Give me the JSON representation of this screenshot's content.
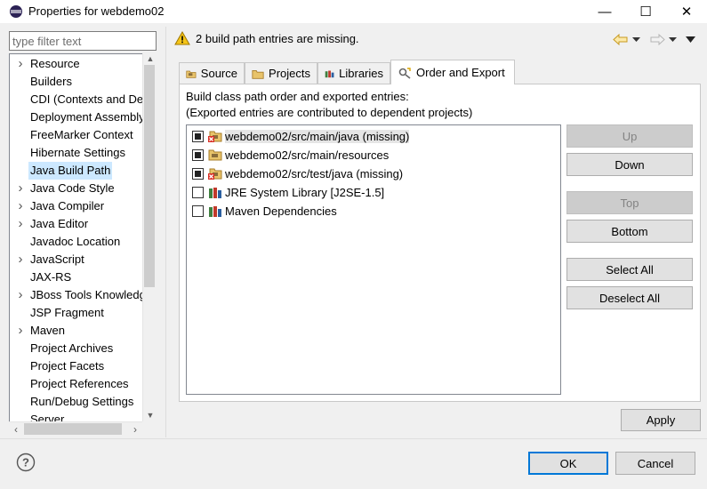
{
  "window": {
    "title": "Properties for webdemo02",
    "minimize_glyph": "—",
    "maximize_glyph": "☐",
    "close_glyph": "✕",
    "icon": "eclipse-icon"
  },
  "filter": {
    "placeholder": "type filter text",
    "value": ""
  },
  "tree": {
    "items": [
      {
        "label": "Resource",
        "expandable": true
      },
      {
        "label": "Builders",
        "expandable": false
      },
      {
        "label": "CDI (Contexts and De",
        "expandable": false
      },
      {
        "label": "Deployment Assembly",
        "expandable": false
      },
      {
        "label": "FreeMarker Context",
        "expandable": false
      },
      {
        "label": "Hibernate Settings",
        "expandable": false
      },
      {
        "label": "Java Build Path",
        "expandable": false,
        "selected": true
      },
      {
        "label": "Java Code Style",
        "expandable": true
      },
      {
        "label": "Java Compiler",
        "expandable": true
      },
      {
        "label": "Java Editor",
        "expandable": true
      },
      {
        "label": "Javadoc Location",
        "expandable": false
      },
      {
        "label": "JavaScript",
        "expandable": true
      },
      {
        "label": "JAX-RS",
        "expandable": false
      },
      {
        "label": "JBoss Tools Knowledg",
        "expandable": true
      },
      {
        "label": "JSP Fragment",
        "expandable": false
      },
      {
        "label": "Maven",
        "expandable": true
      },
      {
        "label": "Project Archives",
        "expandable": false
      },
      {
        "label": "Project Facets",
        "expandable": false
      },
      {
        "label": "Project References",
        "expandable": false
      },
      {
        "label": "Run/Debug Settings",
        "expandable": false
      },
      {
        "label": "Server",
        "expandable": false
      }
    ]
  },
  "header": {
    "warning": "2 build path entries are missing."
  },
  "tabs": [
    {
      "label": "Source",
      "icon": "source-folder-icon"
    },
    {
      "label": "Projects",
      "icon": "projects-folder-icon"
    },
    {
      "label": "Libraries",
      "icon": "libraries-icon"
    },
    {
      "label": "Order and Export",
      "icon": "order-export-icon",
      "active": true
    }
  ],
  "panel": {
    "desc_line1": "Build class path order and exported entries:",
    "desc_line2": "(Exported entries are contributed to dependent projects)",
    "entries": [
      {
        "label": "webdemo02/src/main/java (missing)",
        "checked": true,
        "icon": "missing-source-folder-icon",
        "selected": true
      },
      {
        "label": "webdemo02/src/main/resources",
        "checked": true,
        "icon": "source-folder-icon"
      },
      {
        "label": "webdemo02/src/test/java (missing)",
        "checked": true,
        "icon": "missing-source-folder-icon"
      },
      {
        "label": "JRE System Library [J2SE-1.5]",
        "checked": false,
        "icon": "library-icon"
      },
      {
        "label": "Maven Dependencies",
        "checked": false,
        "icon": "library-icon"
      }
    ],
    "buttons": {
      "up": "Up",
      "down": "Down",
      "top": "Top",
      "bottom": "Bottom",
      "select_all": "Select All",
      "deselect_all": "Deselect All"
    },
    "apply": "Apply"
  },
  "footer": {
    "ok": "OK",
    "cancel": "Cancel"
  },
  "colors": {
    "selection": "#cce8ff",
    "accent": "#0078d7",
    "warning": "#f5c518"
  }
}
